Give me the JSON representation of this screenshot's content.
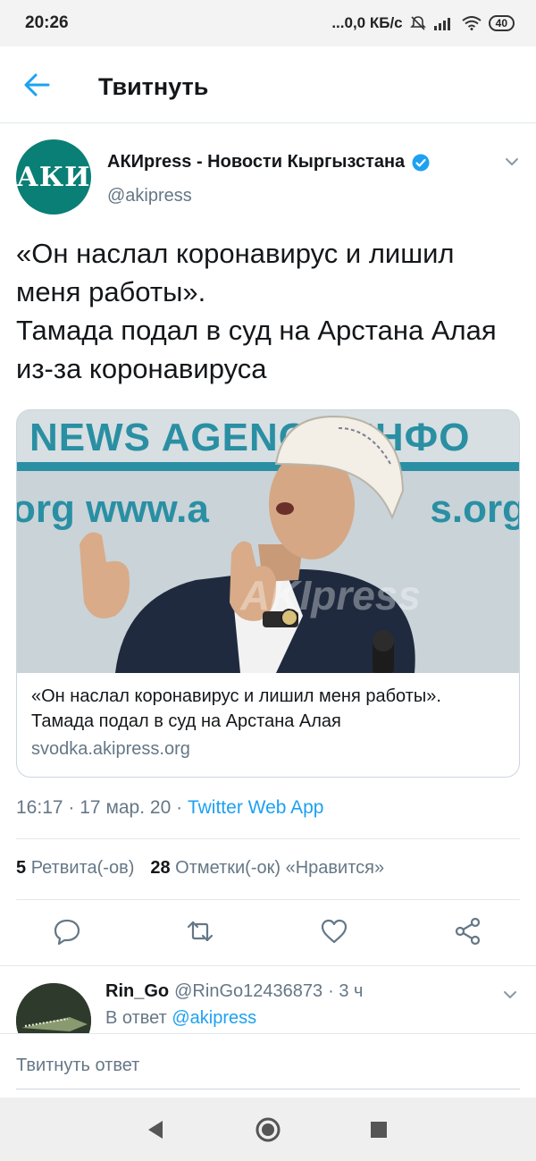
{
  "status_bar": {
    "time": "20:26",
    "network": "...0,0 КБ/с",
    "battery": "40"
  },
  "header": {
    "title": "Твитнуть"
  },
  "tweet": {
    "author_name": "АКИpress - Новости Кыргызстана",
    "author_handle": "@akipress",
    "avatar_text": "АКИ",
    "text": "«Он наслал коронавирус и лишил меня работы».\nТамада подал в суд на Арстана Алая из-за коронавируса",
    "card": {
      "banner_line1": "NEWS AGENCY  ИНФО",
      "banner_line2": "org   www.a",
      "banner_line3": "s.org",
      "watermark": "AKIpress",
      "title": "«Он наслал коронавирус и лишил меня работы».\nТамада подал в суд на Арстана Алая",
      "domain": "svodka.akipress.org"
    },
    "time": "16:17",
    "date": "17 мар. 20",
    "source": "Twitter Web App",
    "retweets_count": "5",
    "retweets_label": "Ретвита(-ов)",
    "likes_count": "28",
    "likes_label": "Отметки(-ок) «Нравится»"
  },
  "reply": {
    "name": "Rin_Go",
    "handle": "@RinGo12436873",
    "age": "· 3 ч",
    "reply_prefix": "В ответ",
    "reply_to": "@akipress"
  },
  "compose": {
    "placeholder": "Твитнуть ответ"
  },
  "colors": {
    "accent": "#1da1f2",
    "avatar": "#0a7f76",
    "secondary_text": "#657786"
  }
}
